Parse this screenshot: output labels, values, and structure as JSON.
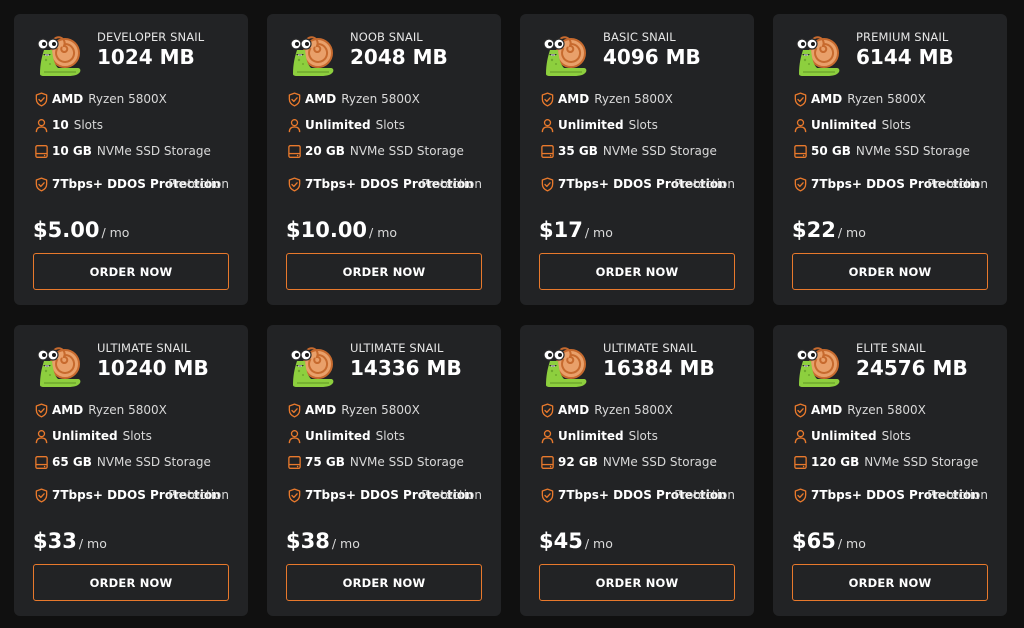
{
  "accent_color": "#e8792c",
  "icons": {
    "mascot": "snail-mascot-icon",
    "cpu": "shield-check-icon",
    "slots": "user-icon",
    "storage": "drive-icon",
    "ddos": "shield-check-icon"
  },
  "plans": [
    {
      "name": "DEVELOPER SNAIL",
      "memory": "1024 MB",
      "cpu_bold": "AMD",
      "cpu_text": "Ryzen 5800X",
      "slots_bold": "10",
      "slots_text": "Slots",
      "storage_bold": "10 GB",
      "storage_text": "NVMe SSD Storage",
      "ddos_bold": "7Tbps+ DDOS Protection",
      "ddos_text": "Protection",
      "price": "$5.00",
      "period": "/ mo",
      "button": "ORDER NOW"
    },
    {
      "name": "NOOB SNAIL",
      "memory": "2048 MB",
      "cpu_bold": "AMD",
      "cpu_text": "Ryzen 5800X",
      "slots_bold": "Unlimited",
      "slots_text": "Slots",
      "storage_bold": "20 GB",
      "storage_text": "NVMe SSD Storage",
      "ddos_bold": "7Tbps+ DDOS Protection",
      "ddos_text": "Protection",
      "price": "$10.00",
      "period": "/ mo",
      "button": "ORDER NOW"
    },
    {
      "name": "BASIC SNAIL",
      "memory": "4096 MB",
      "cpu_bold": "AMD",
      "cpu_text": "Ryzen 5800X",
      "slots_bold": "Unlimited",
      "slots_text": "Slots",
      "storage_bold": "35 GB",
      "storage_text": "NVMe SSD Storage",
      "ddos_bold": "7Tbps+ DDOS Protection",
      "ddos_text": "Protection",
      "price": "$17",
      "period": "/ mo",
      "button": "ORDER NOW"
    },
    {
      "name": "PREMIUM SNAIL",
      "memory": "6144 MB",
      "cpu_bold": "AMD",
      "cpu_text": "Ryzen 5800X",
      "slots_bold": "Unlimited",
      "slots_text": "Slots",
      "storage_bold": "50 GB",
      "storage_text": "NVMe SSD Storage",
      "ddos_bold": "7Tbps+ DDOS Protection",
      "ddos_text": "Protection",
      "price": "$22",
      "period": "/ mo",
      "button": "ORDER NOW"
    },
    {
      "name": "ULTIMATE SNAIL",
      "memory": "10240 MB",
      "cpu_bold": "AMD",
      "cpu_text": "Ryzen 5800X",
      "slots_bold": "Unlimited",
      "slots_text": "Slots",
      "storage_bold": "65 GB",
      "storage_text": "NVMe SSD Storage",
      "ddos_bold": "7Tbps+ DDOS Protection",
      "ddos_text": "Protection",
      "price": "$33",
      "period": "/ mo",
      "button": "ORDER NOW"
    },
    {
      "name": "ULTIMATE SNAIL",
      "memory": "14336 MB",
      "cpu_bold": "AMD",
      "cpu_text": "Ryzen 5800X",
      "slots_bold": "Unlimited",
      "slots_text": "Slots",
      "storage_bold": "75 GB",
      "storage_text": "NVMe SSD Storage",
      "ddos_bold": "7Tbps+ DDOS Protection",
      "ddos_text": "Protection",
      "price": "$38",
      "period": "/ mo",
      "button": "ORDER NOW"
    },
    {
      "name": "ULTIMATE SNAIL",
      "memory": "16384 MB",
      "cpu_bold": "AMD",
      "cpu_text": "Ryzen 5800X",
      "slots_bold": "Unlimited",
      "slots_text": "Slots",
      "storage_bold": "92 GB",
      "storage_text": "NVMe SSD Storage",
      "ddos_bold": "7Tbps+ DDOS Protection",
      "ddos_text": "Protection",
      "price": "$45",
      "period": "/ mo",
      "button": "ORDER NOW"
    },
    {
      "name": "ELITE SNAIL",
      "memory": "24576 MB",
      "cpu_bold": "AMD",
      "cpu_text": "Ryzen 5800X",
      "slots_bold": "Unlimited",
      "slots_text": "Slots",
      "storage_bold": "120 GB",
      "storage_text": "NVMe SSD Storage",
      "ddos_bold": "7Tbps+ DDOS Protection",
      "ddos_text": "Protection",
      "price": "$65",
      "period": "/ mo",
      "button": "ORDER NOW"
    }
  ]
}
